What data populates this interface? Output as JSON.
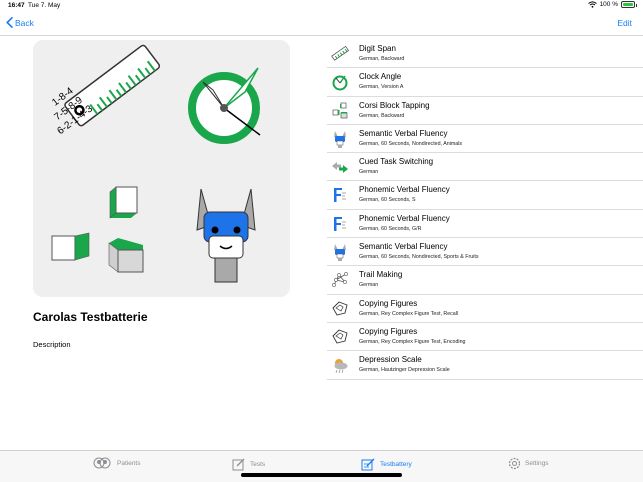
{
  "status_bar": {
    "time": "16:47",
    "date": "Tue 7. May",
    "battery": "100 %"
  },
  "nav": {
    "back_label": "Back",
    "edit_label": "Edit"
  },
  "battery_title": "Carolas Testbatterie",
  "description_label": "Description",
  "tests": [
    {
      "name": "Digit Span",
      "detail": "German, Backward",
      "icon": "digit-span-icon"
    },
    {
      "name": "Clock Angle",
      "detail": "German, Version A",
      "icon": "clock-icon"
    },
    {
      "name": "Corsi Block Tapping",
      "detail": "German, Backward",
      "icon": "blocks-icon"
    },
    {
      "name": "Semantic Verbal Fluency",
      "detail": "German, 60 Seconds, Nondirected, Animals",
      "icon": "llama-icon"
    },
    {
      "name": "Cued Task Switching",
      "detail": "German",
      "icon": "arrows-icon"
    },
    {
      "name": "Phonemic Verbal Fluency",
      "detail": "German, 60 Seconds, S",
      "icon": "letter-f-icon"
    },
    {
      "name": "Phonemic Verbal Fluency",
      "detail": "German, 60 Seconds, G/R",
      "icon": "letter-f-icon"
    },
    {
      "name": "Semantic Verbal Fluency",
      "detail": "German, 60 Seconds, Nondirected, Sports & Fruits",
      "icon": "llama-icon"
    },
    {
      "name": "Trail Making",
      "detail": "German",
      "icon": "trail-icon"
    },
    {
      "name": "Copying Figures",
      "detail": "German, Rey Complex Figure Test, Recall",
      "icon": "figure-icon"
    },
    {
      "name": "Copying Figures",
      "detail": "German, Rey Complex Figure Test, Encoding",
      "icon": "figure-icon"
    },
    {
      "name": "Depression Scale",
      "detail": "German, Hautzinger Depression Scale",
      "icon": "cloud-icon"
    }
  ],
  "tabs": [
    {
      "label": "Patients",
      "icon": "patients-icon",
      "active": false
    },
    {
      "label": "Tests",
      "icon": "tests-icon",
      "active": false
    },
    {
      "label": "Testbattery",
      "icon": "testbattery-icon",
      "active": true
    },
    {
      "label": "Settings",
      "icon": "settings-icon",
      "active": false
    }
  ],
  "hero": {
    "ruler_text": [
      "1-8-4",
      "7-5-8-9",
      "6-2-1-4-3"
    ]
  },
  "colors": {
    "accent": "#1a7cf5",
    "green": "#1aa64a",
    "llama_blue": "#1e73e8"
  }
}
